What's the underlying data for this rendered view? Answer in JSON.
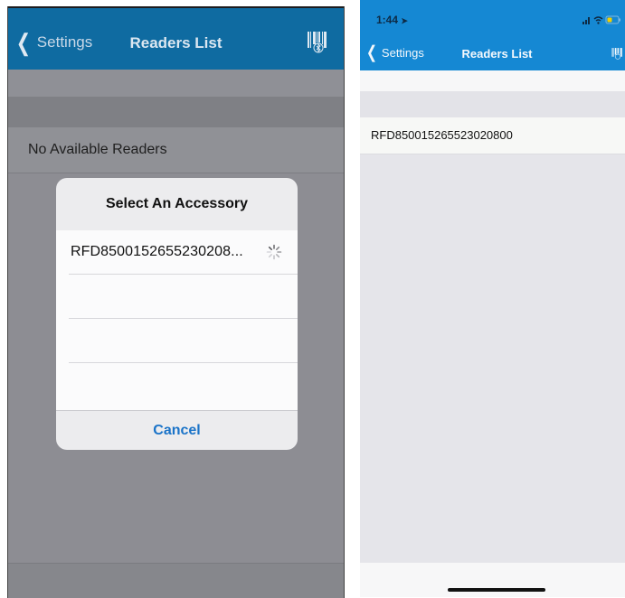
{
  "left_screen": {
    "nav": {
      "back_label": "Settings",
      "title": "Readers List",
      "barcode_icon": "barcode-bluetooth-icon"
    },
    "status_text": "No Available Readers",
    "modal": {
      "title": "Select An Accessory",
      "items": [
        {
          "label": "RFD8500152655230208...",
          "loading": true
        },
        {
          "label": ""
        },
        {
          "label": ""
        },
        {
          "label": ""
        }
      ],
      "cancel_label": "Cancel"
    }
  },
  "right_screen": {
    "status_bar": {
      "time": "1:44"
    },
    "nav": {
      "back_label": "Settings",
      "title": "Readers List",
      "barcode_icon": "barcode-bluetooth-icon"
    },
    "readers": [
      "RFD850015265523020800"
    ]
  },
  "colors": {
    "left_nav": "#0f6ba1",
    "right_nav": "#1588d3",
    "cancel_blue": "#1a73c8",
    "dim_overlay_bg": "#8d8d93"
  }
}
